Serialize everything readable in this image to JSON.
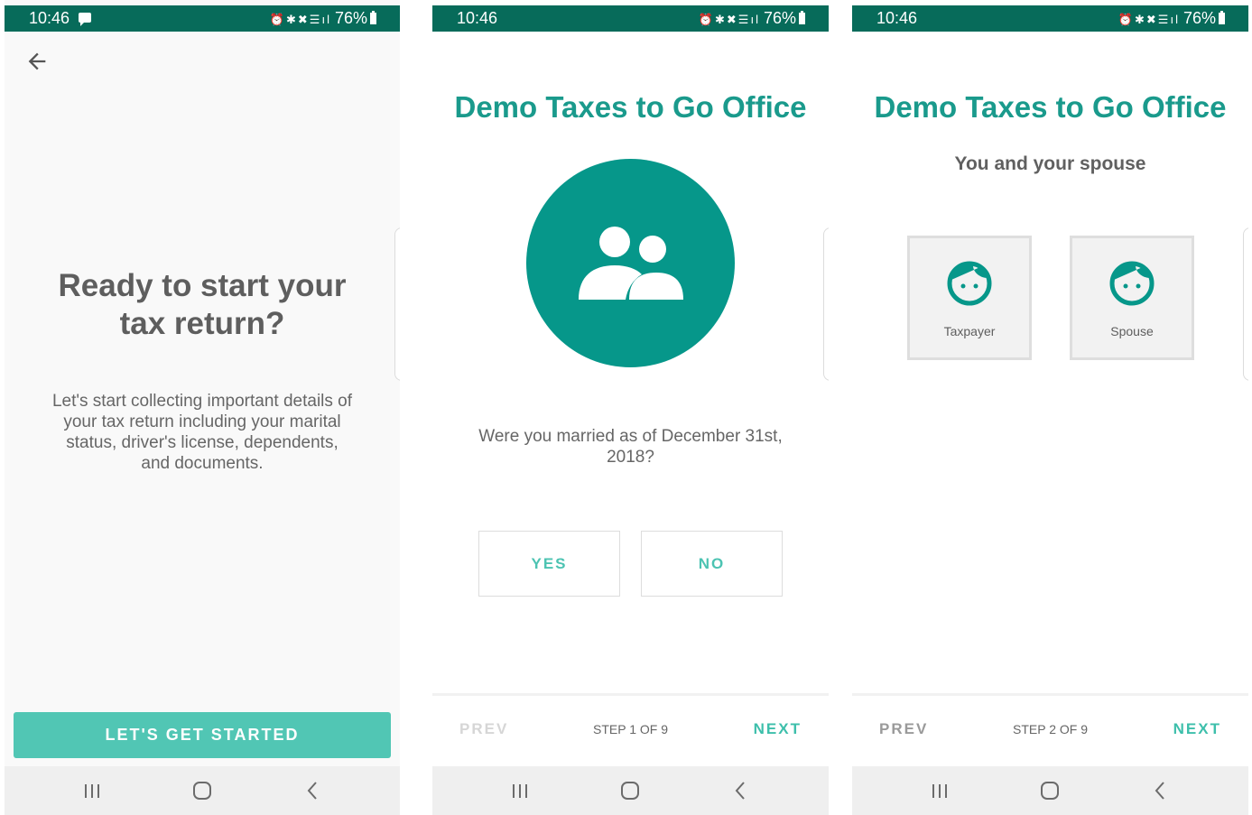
{
  "status_bar": {
    "time": "10:46",
    "battery": "76%"
  },
  "screen1": {
    "headline_line1": "Ready to start your",
    "headline_line2": "tax return?",
    "intro_text": "Let's start collecting important details of your tax return including your marital status, driver's license, dependents, and documents.",
    "cta_label": "LET'S GET STARTED"
  },
  "screen2": {
    "title": "Demo Taxes to Go Office",
    "question": "Were you married as of December 31st, 2018?",
    "yes_label": "YES",
    "no_label": "NO",
    "prev_label": "PREV",
    "step_label": "STEP 1 OF 9",
    "next_label": "NEXT"
  },
  "screen3": {
    "title": "Demo Taxes to Go Office",
    "subtitle": "You and your spouse",
    "taxpayer_label": "Taxpayer",
    "spouse_label": "Spouse",
    "prev_label": "PREV",
    "step_label": "STEP 2 OF 9",
    "next_label": "NEXT"
  },
  "colors": {
    "status_bar": "#076b5a",
    "brand_teal": "#06978a",
    "accent_teal": "#51c6b4",
    "title_teal": "#1a9a8c"
  },
  "icons": {
    "back": "arrow-left-icon",
    "people": "people-icon",
    "face": "face-icon",
    "nav_recents": "recents-icon",
    "nav_home": "home-icon",
    "nav_back": "back-chevron-icon"
  }
}
